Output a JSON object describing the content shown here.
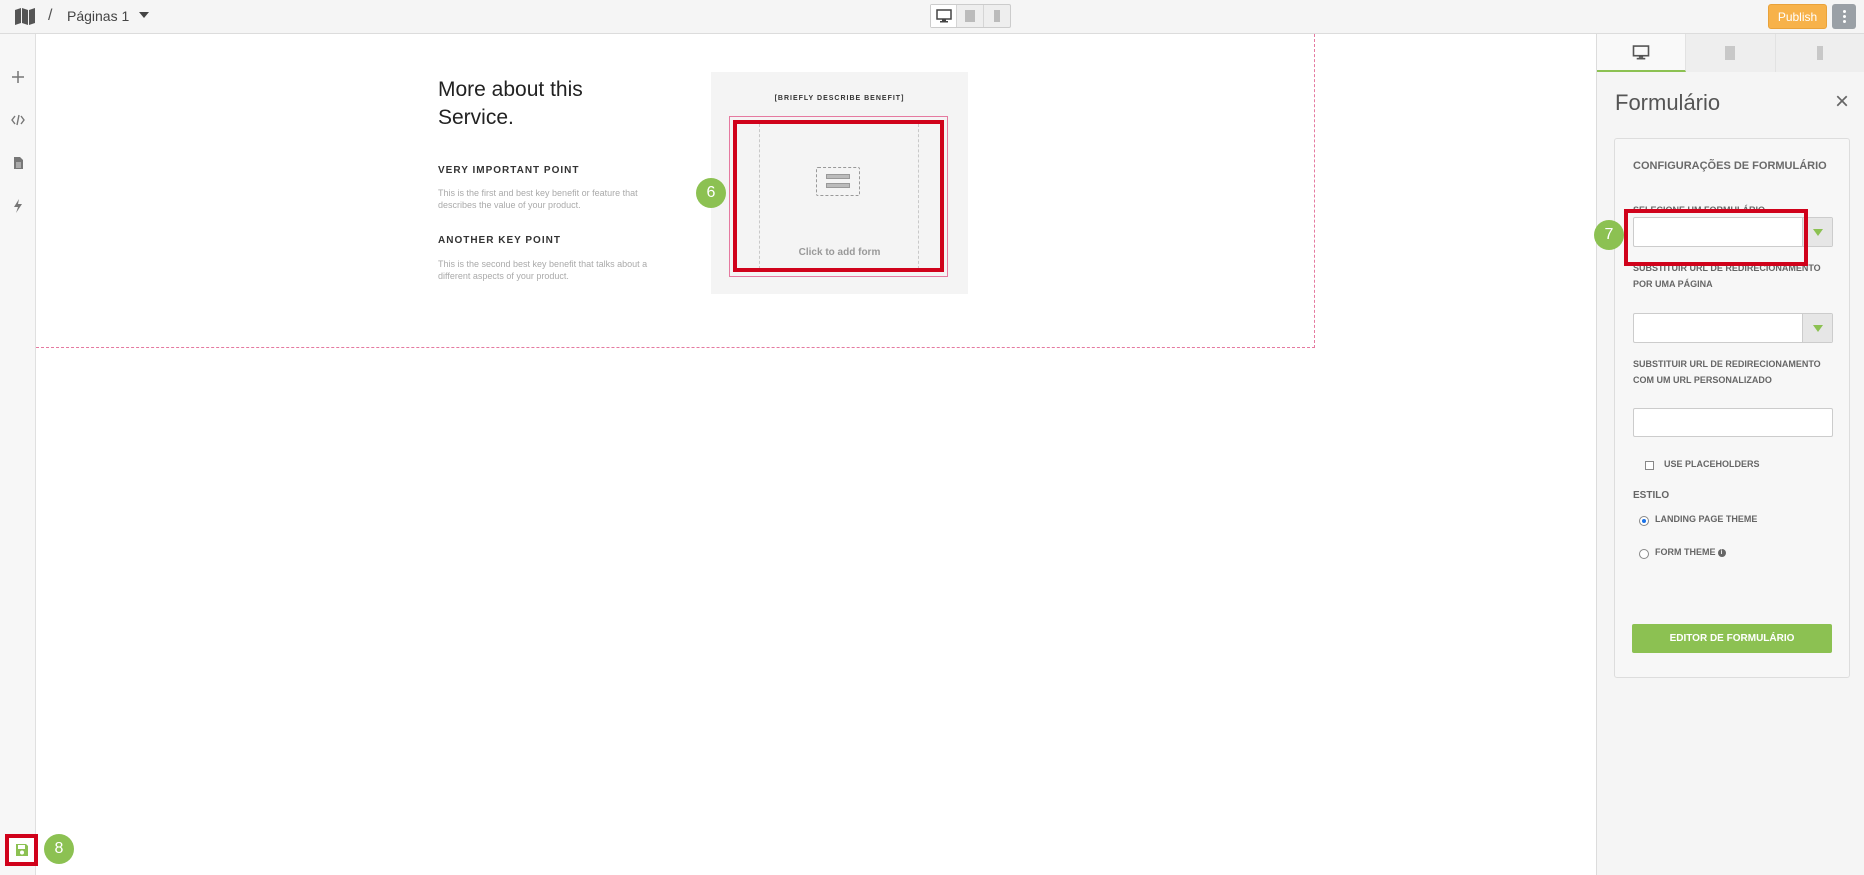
{
  "topbar": {
    "breadcrumb_separator": "/",
    "page_name": "Páginas 1",
    "publish_label": "Publish"
  },
  "canvas": {
    "section_title": "More about this Service.",
    "point1_title": "VERY IMPORTANT POINT",
    "point1_desc": "This is the first and best key benefit or feature that describes the value of your product.",
    "point2_title": "ANOTHER KEY POINT",
    "point2_desc": "This is the second best key benefit that talks about a different aspects of your product.",
    "form_card_title": "[BRIEFLY DESCRIBE BENEFIT]",
    "form_placeholder": "Click to add form"
  },
  "badges": {
    "b6": "6",
    "b7": "7",
    "b8": "8"
  },
  "panel": {
    "title": "Formulário",
    "close_symbol": "×",
    "section_heading": "CONFIGURAÇÕES DE FORMULÁRIO",
    "select_form_label": "SELECIONE UM FORMULÁRIO",
    "select_form_value": "",
    "redirect_page_label": "SUBSTITUIR URL DE REDIRECIONAMENTO POR UMA PÁGINA",
    "redirect_page_value": "",
    "redirect_url_label": "SUBSTITUIR URL DE REDIRECIONAMENTO COM UM URL PERSONALIZADO",
    "redirect_url_value": "",
    "use_placeholders_label": "USE PLACEHOLDERS",
    "use_placeholders_checked": false,
    "style_heading": "ESTILO",
    "style_options": [
      "LANDING PAGE THEME",
      "FORM THEME"
    ],
    "style_selected": "LANDING PAGE THEME",
    "editor_button": "EDITOR DE FORMULÁRIO"
  },
  "icons": {
    "logo": "map-icon",
    "leftbar": [
      "plus-icon",
      "code-icon",
      "page-icon",
      "bolt-icon"
    ],
    "devices": [
      "desktop-icon",
      "tablet-icon",
      "mobile-icon"
    ],
    "save": "save-icon"
  },
  "colors": {
    "accent_green": "#8cc152",
    "publish_orange": "#f7b24a",
    "highlight_red": "#d0021b",
    "guide_pink": "#e57aa0"
  }
}
